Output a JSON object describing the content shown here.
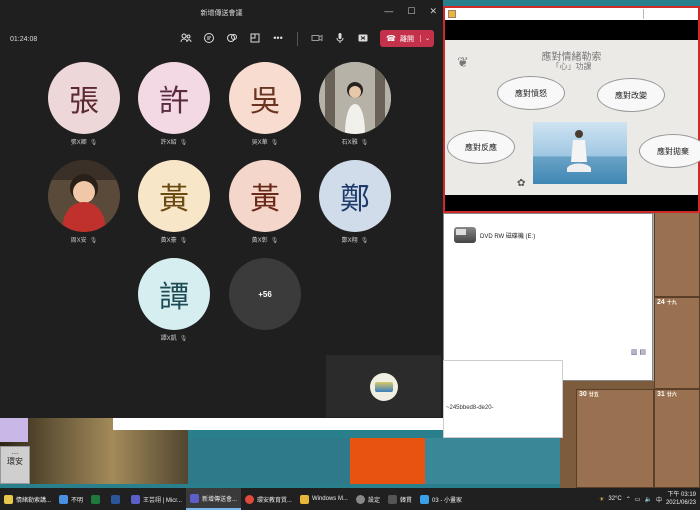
{
  "teams": {
    "window_title": "新增傳送會議",
    "elapsed": "01:24:08",
    "leave_label": "離開",
    "participants": [
      {
        "initial": "張",
        "name": "張X卿",
        "bg": "#eed7d8",
        "fg": "#5a2a30"
      },
      {
        "initial": "許",
        "name": "許X紹",
        "bg": "#f3d9e4",
        "fg": "#5a2a40"
      },
      {
        "initial": "吳",
        "name": "吳X華",
        "bg": "#f7dccf",
        "fg": "#6a3520"
      },
      {
        "initial": "",
        "name": "石X雅",
        "bg": "#888",
        "fg": "#fff"
      },
      {
        "initial": "",
        "name": "周X安",
        "bg": "#a33",
        "fg": "#fff"
      },
      {
        "initial": "黃",
        "name": "黃X豪",
        "bg": "#f7e6c8",
        "fg": "#6a4a10"
      },
      {
        "initial": "黃",
        "name": "黃X彰",
        "bg": "#f5d6cb",
        "fg": "#6a2a1a"
      },
      {
        "initial": "鄭",
        "name": "鄭X翔",
        "bg": "#d1dcea",
        "fg": "#1d3a6a"
      },
      {
        "initial": "譚",
        "name": "譚X凱",
        "bg": "#d6eef0",
        "fg": "#1d4a55"
      }
    ],
    "more_count": "+56"
  },
  "slide": {
    "title": "應對情緒勒索",
    "subtitle": "「心」功課",
    "clouds": [
      "應對憤怒",
      "應對改變",
      "應對反應",
      "應對拋棄"
    ]
  },
  "explorer": {
    "drive_label": "DVD RW 磁碟機 (E:)"
  },
  "textwin": {
    "snippet": "~245bbed8-de20-"
  },
  "side_widget": {
    "dots": "...",
    "label": "環安"
  },
  "calendar": {
    "cells": [
      {
        "num": "17",
        "sub": "十二"
      },
      {
        "num": "24",
        "sub": "十九"
      },
      {
        "num": "30",
        "sub": "廿五"
      },
      {
        "num": "31",
        "sub": "廿六"
      }
    ]
  },
  "taskbar": {
    "items": [
      {
        "label": "情緒勒索講...",
        "color": "#e8c84a"
      },
      {
        "label": "不明",
        "color": "#4a90e2"
      },
      {
        "label": "",
        "color": "#1d7a3a"
      },
      {
        "label": "",
        "color": "#2b579a"
      },
      {
        "label": "王芸翊 | Micr...",
        "color": "#5b5fc7"
      },
      {
        "label": "新增傳送會...",
        "color": "#5b5fc7",
        "active": true
      },
      {
        "label": "環安教育質...",
        "color": "#e04a3a"
      },
      {
        "label": "Windows M...",
        "color": "#e8b63a"
      },
      {
        "label": "設定",
        "color": "#888"
      },
      {
        "label": "韓貫",
        "color": "#555"
      },
      {
        "label": "03 - 小畫家",
        "color": "#3aa0e8"
      }
    ],
    "weather": "32°C",
    "time": "下午 03:19",
    "date": "2021/06/23"
  }
}
